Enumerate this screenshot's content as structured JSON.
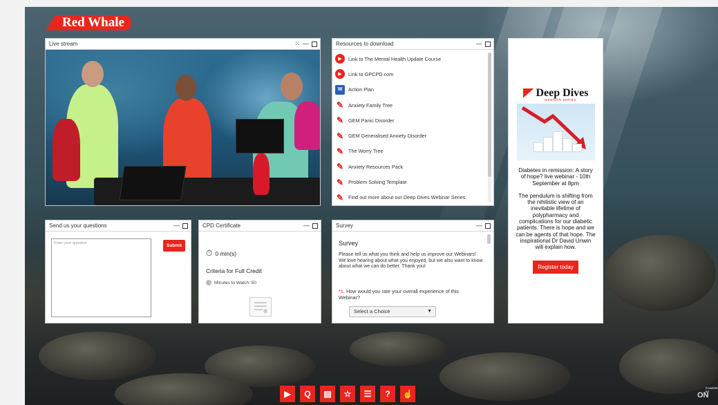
{
  "brand": {
    "logo_text": "Red Whale"
  },
  "live_stream": {
    "title": "Live stream",
    "controls": [
      "expand-icon",
      "minimize-icon",
      "maximize-icon"
    ]
  },
  "resources": {
    "title": "Resources to download",
    "items": [
      {
        "label": "Link to The Mental Health Update Course",
        "icon": "play-link-icon"
      },
      {
        "label": "Link to GPCPD.com",
        "icon": "play-link-icon"
      },
      {
        "label": "Action Plan",
        "icon": "word-doc-icon"
      },
      {
        "label": "Anxiety Family Tree",
        "icon": "pdf-icon"
      },
      {
        "label": "GEM Panic Disorder",
        "icon": "pdf-icon"
      },
      {
        "label": "GEM Generalised Anxiety Disorder",
        "icon": "pdf-icon"
      },
      {
        "label": "The Worry Tree",
        "icon": "pdf-icon"
      },
      {
        "label": "Anxiety Resources Pack",
        "icon": "pdf-icon"
      },
      {
        "label": "Problem Solving Template",
        "icon": "pdf-icon"
      },
      {
        "label": "Find out more about our Deep Dives Webinar Series",
        "icon": "pdf-icon"
      }
    ]
  },
  "ad": {
    "logo_title": "Deep Dives",
    "logo_sub": "WEBINAR SERIES",
    "headline": "Diabetes in remission: A story of hope? live webinar - 10th September at 8pm",
    "body": "The pendulum is shifting from the nihilistic view of an inevitable lifetime of polypharmacy and complications for our diabetic patients. There is hope and we can be agents of that hope. The inspirational Dr David Unwin will explain how.",
    "cta": "Register today"
  },
  "questions": {
    "title": "Send us your questions",
    "placeholder": "Enter your question",
    "submit_label": "Submit"
  },
  "cpd": {
    "title": "CPD Certificate",
    "timer": "0 min(s)",
    "criteria_title": "Criteria for Full Credit",
    "minutes_label": "Minutes to Watch: 50"
  },
  "survey": {
    "title": "Survey",
    "heading": "Survey",
    "intro": "Please tell us what you think and help us improve our Webinars! We love hearing about what you enjoyed, but we also want to know about what we can do better. Thank you!",
    "question_number": "*1.",
    "question": "How would you rate your overall experience of this Webinar?",
    "select_value": "Select a Choice"
  },
  "toolbar": {
    "buttons": [
      {
        "icon": "play-icon",
        "glyph": "▶"
      },
      {
        "icon": "search-icon",
        "glyph": "Q"
      },
      {
        "icon": "document-icon",
        "glyph": "▤"
      },
      {
        "icon": "certificate-icon",
        "glyph": "☆"
      },
      {
        "icon": "checklist-icon",
        "glyph": "☰"
      },
      {
        "icon": "help-icon",
        "glyph": "?"
      },
      {
        "icon": "touch-icon",
        "glyph": "☝"
      }
    ]
  },
  "footer": {
    "powered_by": "POWERED BY",
    "powered_brand": "ON"
  },
  "colors": {
    "accent": "#e8261f",
    "panel_bg": "#ffffff",
    "word_blue": "#2b5fb3"
  }
}
